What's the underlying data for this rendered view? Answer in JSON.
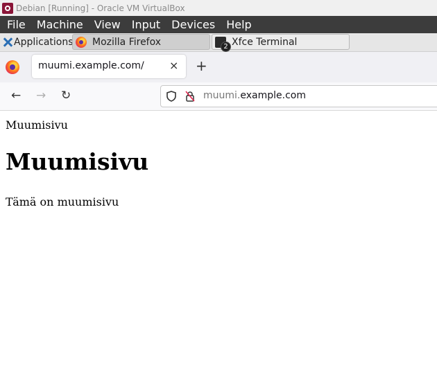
{
  "vbox": {
    "title": "Debian [Running] - Oracle VM VirtualBox",
    "menu": [
      "File",
      "Machine",
      "View",
      "Input",
      "Devices",
      "Help"
    ]
  },
  "panel": {
    "applications_label": "Applications",
    "separator": "⠿",
    "tasks": [
      {
        "label": "Mozilla Firefox",
        "icon": "firefox-icon",
        "active": true
      },
      {
        "label": "Xfce Terminal",
        "icon": "terminal-icon",
        "badge": "2",
        "active": false
      }
    ]
  },
  "browser": {
    "tab_title": "muumi.example.com/",
    "tab_close": "×",
    "new_tab": "+",
    "nav": {
      "back": "←",
      "forward": "→",
      "reload": "↻"
    },
    "url_sub": "muumi.",
    "url_domain": "example.com"
  },
  "page": {
    "title_text": "Muumisivu",
    "heading": "Muumisivu",
    "paragraph": "Tämä on muumisivu"
  }
}
